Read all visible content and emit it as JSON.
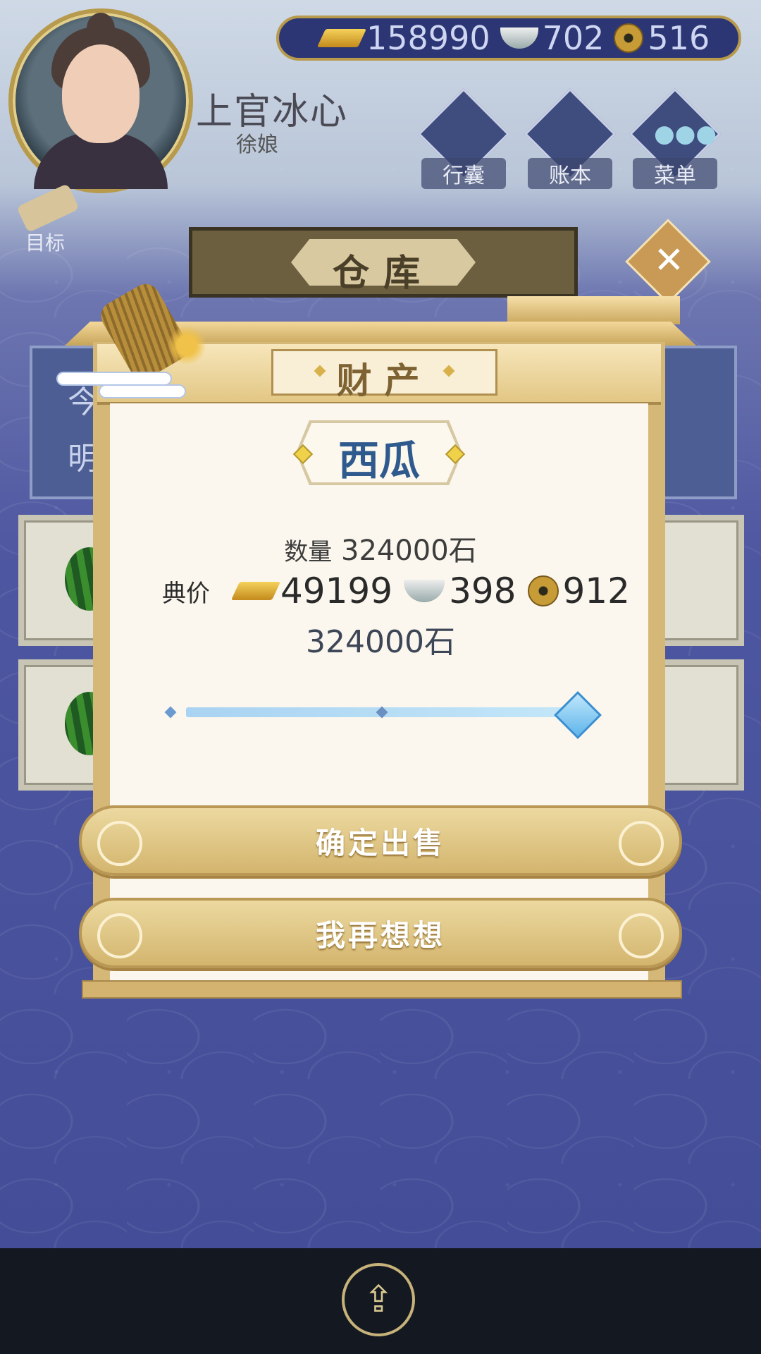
{
  "player": {
    "name": "上官冰心",
    "title": "徐娘"
  },
  "currency": {
    "gold": "158990",
    "silver": "702",
    "copper": "516"
  },
  "top_menu": [
    {
      "label": "行囊",
      "icon": "bag-icon"
    },
    {
      "label": "账本",
      "icon": "ledger-icon"
    },
    {
      "label": "菜单",
      "icon": "more-icon"
    }
  ],
  "goal_label": "目标",
  "background": {
    "panel_title": "仓库",
    "date_chars": [
      "今",
      "明"
    ]
  },
  "dialog": {
    "title": "财产",
    "item_name": "西瓜",
    "quantity_label": "数量",
    "quantity_value": "324000石",
    "price_label": "典价",
    "price_gold": "49199",
    "price_silver": "398",
    "price_copper": "912",
    "sell_amount": "324000石",
    "slider_fraction": 1.0,
    "confirm_label": "确定出售",
    "cancel_label": "我再想想"
  },
  "colors": {
    "accent_gold": "#d3b56e",
    "item_name_blue": "#2f5a8e",
    "slider_blue": "#5fb5ec"
  }
}
